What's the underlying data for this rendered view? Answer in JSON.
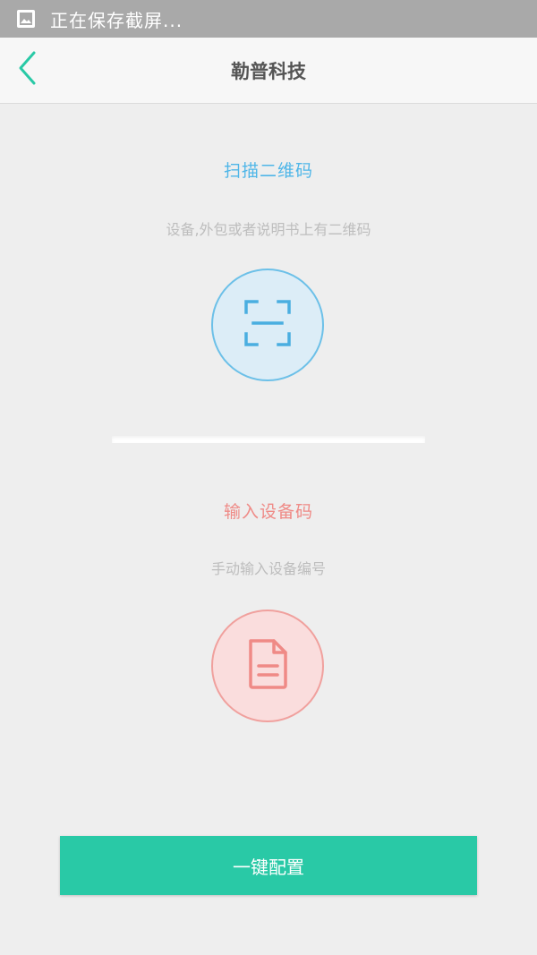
{
  "status_bar": {
    "icon": "image-icon",
    "text": "正在保存截屏..."
  },
  "header": {
    "back_icon": "chevron-left-icon",
    "title": "勒普科技"
  },
  "scan_section": {
    "title": "扫描二维码",
    "subtitle": "设备,外包或者说明书上有二维码",
    "icon": "scan-qr-icon"
  },
  "manual_section": {
    "title": "输入设备码",
    "subtitle": "手动输入设备编号",
    "icon": "document-icon"
  },
  "footer": {
    "config_button_label": "一键配置"
  },
  "colors": {
    "accent": "#29c9a6",
    "scan_blue": "#4fb6e8",
    "manual_red": "#ef8a86",
    "background": "#eeeeee"
  }
}
